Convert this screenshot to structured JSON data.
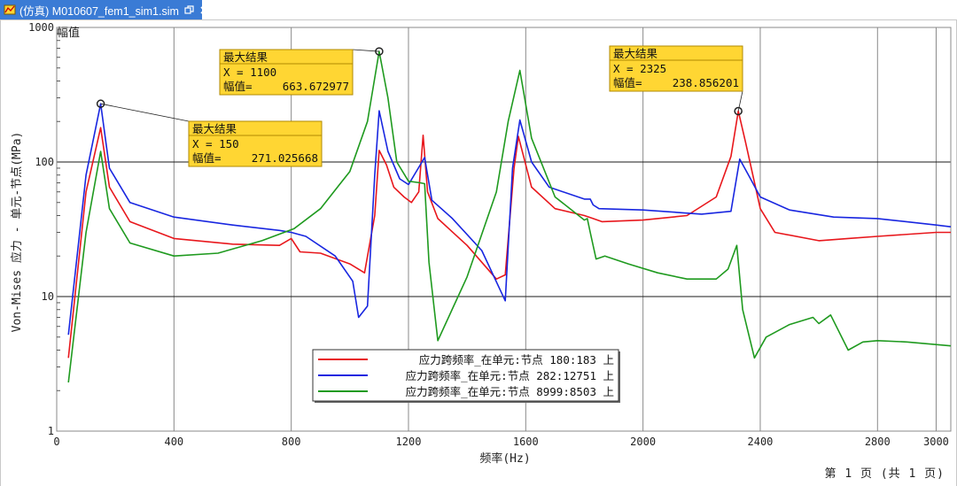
{
  "window": {
    "tab_title": "(仿真) M010607_fem1_sim1.sim",
    "icon": "simulation-app-icon",
    "restore_icon": "restore-icon",
    "close_icon": "close-icon"
  },
  "footer": {
    "page_text": "第 1 页 (共 1 页)"
  },
  "colors": {
    "red": "#e8171c",
    "blue": "#1826e0",
    "green": "#1f9a1f",
    "callout_bg": "#ffd633",
    "callout_border": "#b08a00"
  },
  "chart_data": {
    "type": "line",
    "xlabel": "频率(Hz)",
    "ylabel": "Von-Mises 应力 - 单元-节点(MPa)",
    "y_unit_label": "幅值",
    "xlim": [
      0,
      3050
    ],
    "ylim": [
      1,
      1000
    ],
    "yscale": "log",
    "grid": true,
    "x_ticks": [
      0,
      400,
      800,
      1200,
      1600,
      2000,
      2400,
      2800,
      3000
    ],
    "y_ticks": [
      1,
      10,
      100,
      1000
    ],
    "legend_position": "bottom-center",
    "series": [
      {
        "name": "应力跨频率_在单元:节点 180:183 上",
        "color": "#e8171c",
        "points": [
          [
            40,
            3.5
          ],
          [
            100,
            60
          ],
          [
            150,
            180
          ],
          [
            180,
            65
          ],
          [
            250,
            36
          ],
          [
            400,
            27
          ],
          [
            600,
            24.5
          ],
          [
            760,
            24
          ],
          [
            800,
            27
          ],
          [
            830,
            21.5
          ],
          [
            900,
            21
          ],
          [
            1000,
            17.5
          ],
          [
            1050,
            15
          ],
          [
            1085,
            40
          ],
          [
            1100,
            122
          ],
          [
            1125,
            95
          ],
          [
            1150,
            65
          ],
          [
            1185,
            55
          ],
          [
            1210,
            50
          ],
          [
            1235,
            60
          ],
          [
            1250,
            158
          ],
          [
            1265,
            60
          ],
          [
            1300,
            38
          ],
          [
            1400,
            24
          ],
          [
            1500,
            13.5
          ],
          [
            1530,
            14.5
          ],
          [
            1560,
            90
          ],
          [
            1575,
            155
          ],
          [
            1620,
            65
          ],
          [
            1700,
            45
          ],
          [
            1800,
            40
          ],
          [
            1830,
            38
          ],
          [
            1860,
            36
          ],
          [
            2000,
            37
          ],
          [
            2150,
            40
          ],
          [
            2250,
            55
          ],
          [
            2300,
            110
          ],
          [
            2325,
            238.856201
          ],
          [
            2350,
            140
          ],
          [
            2400,
            45
          ],
          [
            2450,
            30
          ],
          [
            2600,
            26
          ],
          [
            2700,
            27
          ],
          [
            2800,
            28
          ],
          [
            3000,
            30
          ],
          [
            3050,
            30
          ]
        ]
      },
      {
        "name": "应力跨频率_在单元:节点 282:12751 上",
        "color": "#1826e0",
        "points": [
          [
            40,
            5.2
          ],
          [
            100,
            80
          ],
          [
            150,
            271.025668
          ],
          [
            180,
            90
          ],
          [
            250,
            50
          ],
          [
            400,
            39
          ],
          [
            600,
            34
          ],
          [
            760,
            31
          ],
          [
            800,
            30
          ],
          [
            850,
            28
          ],
          [
            950,
            20
          ],
          [
            1010,
            13
          ],
          [
            1030,
            7
          ],
          [
            1060,
            8.5
          ],
          [
            1085,
            80
          ],
          [
            1100,
            240
          ],
          [
            1130,
            120
          ],
          [
            1170,
            75
          ],
          [
            1200,
            68
          ],
          [
            1240,
            95
          ],
          [
            1255,
            108
          ],
          [
            1280,
            52
          ],
          [
            1350,
            38
          ],
          [
            1450,
            22
          ],
          [
            1530,
            9.3
          ],
          [
            1555,
            90
          ],
          [
            1580,
            205
          ],
          [
            1620,
            100
          ],
          [
            1680,
            65
          ],
          [
            1800,
            53
          ],
          [
            1820,
            53
          ],
          [
            1830,
            48
          ],
          [
            1850,
            45
          ],
          [
            2000,
            44
          ],
          [
            2200,
            41
          ],
          [
            2300,
            43
          ],
          [
            2330,
            105
          ],
          [
            2360,
            80
          ],
          [
            2400,
            55
          ],
          [
            2500,
            44
          ],
          [
            2650,
            39
          ],
          [
            2800,
            38
          ],
          [
            3000,
            34
          ],
          [
            3050,
            33
          ]
        ]
      },
      {
        "name": "应力跨频率_在单元:节点 8999:8503 上",
        "color": "#1f9a1f",
        "points": [
          [
            40,
            2.3
          ],
          [
            100,
            30
          ],
          [
            150,
            120
          ],
          [
            180,
            45
          ],
          [
            250,
            25
          ],
          [
            400,
            20
          ],
          [
            550,
            21
          ],
          [
            700,
            26
          ],
          [
            810,
            32
          ],
          [
            900,
            45
          ],
          [
            1000,
            85
          ],
          [
            1060,
            200
          ],
          [
            1100,
            663.672977
          ],
          [
            1130,
            300
          ],
          [
            1160,
            100
          ],
          [
            1200,
            72
          ],
          [
            1240,
            70
          ],
          [
            1255,
            69
          ],
          [
            1270,
            18
          ],
          [
            1300,
            4.7
          ],
          [
            1400,
            14
          ],
          [
            1500,
            60
          ],
          [
            1540,
            200
          ],
          [
            1580,
            480
          ],
          [
            1620,
            150
          ],
          [
            1700,
            55
          ],
          [
            1800,
            37
          ],
          [
            1810,
            38
          ],
          [
            1820,
            30
          ],
          [
            1840,
            19
          ],
          [
            1870,
            20
          ],
          [
            1950,
            17.5
          ],
          [
            2050,
            15
          ],
          [
            2150,
            13.5
          ],
          [
            2250,
            13.5
          ],
          [
            2290,
            16
          ],
          [
            2320,
            24
          ],
          [
            2340,
            8
          ],
          [
            2380,
            3.5
          ],
          [
            2420,
            5
          ],
          [
            2500,
            6.2
          ],
          [
            2580,
            7
          ],
          [
            2600,
            6.3
          ],
          [
            2640,
            7.3
          ],
          [
            2700,
            4
          ],
          [
            2750,
            4.6
          ],
          [
            2800,
            4.7
          ],
          [
            2900,
            4.6
          ],
          [
            3050,
            4.3
          ]
        ]
      }
    ],
    "annotations": [
      {
        "title": "最大结果",
        "x_label": "X = 150",
        "value_label": "幅值=",
        "value": "271.025668",
        "x": 150,
        "y": 271.025668
      },
      {
        "title": "最大结果",
        "x_label": "X = 1100",
        "value_label": "幅值=",
        "value": "663.672977",
        "x": 1100,
        "y": 663.672977
      },
      {
        "title": "最大结果",
        "x_label": "X = 2325",
        "value_label": "幅值=",
        "value": "238.856201",
        "x": 2325,
        "y": 238.856201
      }
    ]
  }
}
